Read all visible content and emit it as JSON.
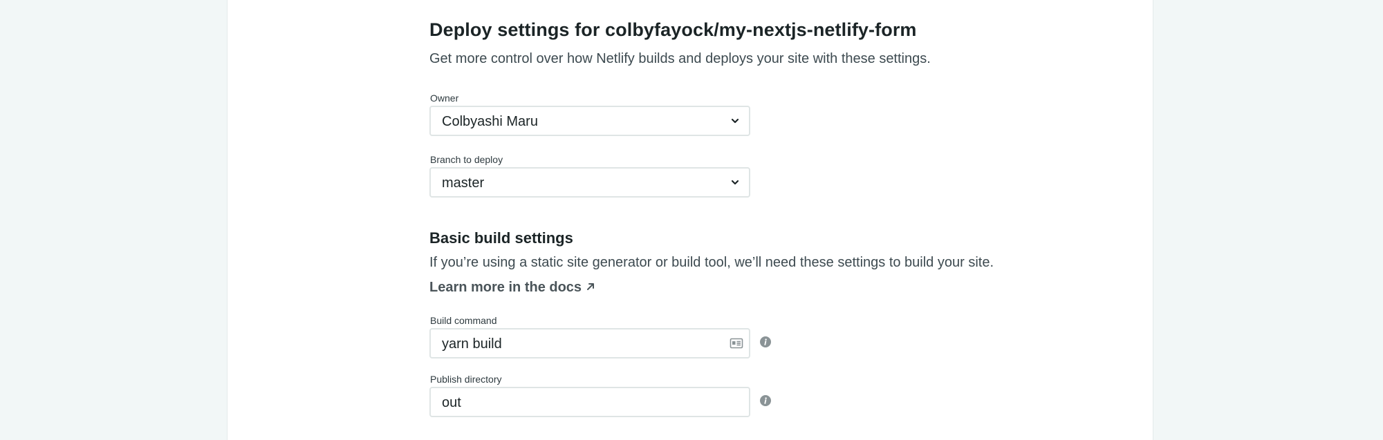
{
  "header": {
    "title": "Deploy settings for colbyfayock/my-nextjs-netlify-form",
    "subtitle": "Get more control over how Netlify builds and deploys your site with these settings."
  },
  "owner": {
    "label": "Owner",
    "value": "Colbyashi Maru"
  },
  "branch": {
    "label": "Branch to deploy",
    "value": "master"
  },
  "build_settings": {
    "heading": "Basic build settings",
    "description": "If you’re using a static site generator or build tool, we’ll need these settings to build your site.",
    "docs_link": "Learn more in the docs"
  },
  "build_command": {
    "label": "Build command",
    "value": "yarn build"
  },
  "publish_directory": {
    "label": "Publish directory",
    "value": "out"
  },
  "icons": {
    "dropdown": "chevron-down-icon",
    "external": "arrow-up-right-icon",
    "field_action": "id-card-icon",
    "info": "info-icon"
  },
  "colors": {
    "background": "#f2f7f7",
    "card": "#ffffff",
    "text": "#1b2426",
    "muted": "#3d4a50",
    "border": "#dfe5e5",
    "info": "#8a9396"
  }
}
